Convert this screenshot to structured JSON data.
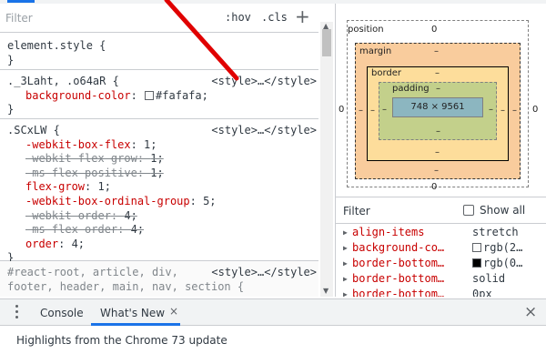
{
  "styles": {
    "filter_placeholder": "Filter",
    "hov": ":hov",
    "cls": ".cls",
    "plus": "+",
    "rules": [
      {
        "selector": "element.style {",
        "close": "}"
      },
      {
        "selector": "._3Laht, .o64aR {",
        "source": "<style>…</style>",
        "decls": [
          {
            "name": "background-color",
            "value": "#fafafa;"
          }
        ],
        "close": "}"
      },
      {
        "selector": ".SCxLW {",
        "source": "<style>…</style>",
        "decls": [
          {
            "name": "-webkit-box-flex",
            "value": "1;"
          },
          {
            "name": "-webkit-flex-grow",
            "value": "1;"
          },
          {
            "name": "-ms-flex-positive",
            "value": "1;"
          },
          {
            "name": "flex-grow",
            "value": "1;"
          },
          {
            "name": "-webkit-box-ordinal-group",
            "value": "5;"
          },
          {
            "name": "-webkit-order",
            "value": "4;"
          },
          {
            "name": "-ms-flex-order",
            "value": "4;"
          },
          {
            "name": "order",
            "value": "4;"
          }
        ],
        "close": "}"
      },
      {
        "selector_line1": "#react-root, article, div,",
        "selector_line2": "footer, header, main, nav, section {",
        "source": "<style>…</style>"
      }
    ]
  },
  "box_model": {
    "position_label": "position",
    "position_value": "0",
    "margin_label": "margin",
    "margin_value": "–",
    "border_label": "border",
    "border_value": "–",
    "padding_label": "padding",
    "padding_value": "–",
    "content_size": "748 × 9561",
    "side_dash": "–",
    "left_value": "0",
    "right_value": "0",
    "bottom_value": "–",
    "outer_bottom": "0"
  },
  "computed": {
    "filter_label": "Filter",
    "show_all": "Show all",
    "rows": [
      {
        "name": "align-items",
        "value": "stretch"
      },
      {
        "name": "background-co…",
        "value": "rgb(2…",
        "swatch": "#fafafa"
      },
      {
        "name": "border-bottom…",
        "value": "rgb(0…",
        "swatch": "#000000"
      },
      {
        "name": "border-bottom…",
        "value": "solid"
      },
      {
        "name": "border-bottom…",
        "value": "0px"
      }
    ]
  },
  "drawer": {
    "tabs": [
      {
        "label": "Console"
      },
      {
        "label": "What's New"
      }
    ],
    "tab_close": "×",
    "close": "×",
    "highlights": "Highlights from the Chrome 73 update"
  },
  "colors": {
    "accent": "#1a73e8",
    "property_name": "#c80000",
    "annotation": "#e00000"
  }
}
